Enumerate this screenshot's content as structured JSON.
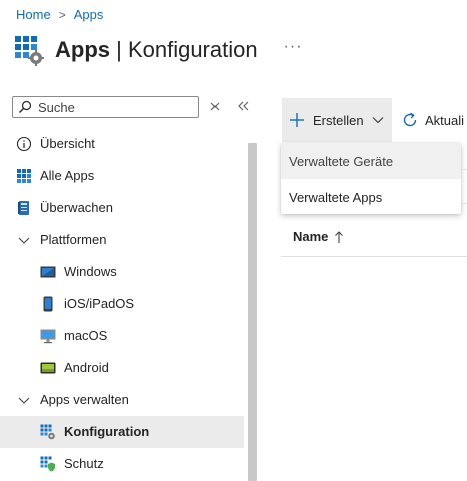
{
  "breadcrumb": {
    "home": "Home",
    "separator": ">",
    "apps": "Apps"
  },
  "header": {
    "title_bold": "Apps",
    "title_rest": " | Konfiguration",
    "more": "···"
  },
  "sidebar": {
    "search_placeholder": "Suche",
    "items": [
      {
        "label": "Übersicht",
        "icon": "info-icon"
      },
      {
        "label": "Alle Apps",
        "icon": "grid-apps-icon"
      },
      {
        "label": "Überwachen",
        "icon": "monitor-book-icon"
      },
      {
        "label": "Plattformen",
        "icon": "chevron-down-icon"
      },
      {
        "label": "Windows",
        "icon": "windows-device-icon"
      },
      {
        "label": "iOS/iPadOS",
        "icon": "ios-device-icon"
      },
      {
        "label": "macOS",
        "icon": "macos-device-icon"
      },
      {
        "label": "Android",
        "icon": "android-device-icon"
      },
      {
        "label": "Apps verwalten",
        "icon": "chevron-down-icon"
      },
      {
        "label": "Konfiguration",
        "icon": "apps-config-icon",
        "active": true
      },
      {
        "label": "Schutz",
        "icon": "apps-protection-icon"
      }
    ]
  },
  "toolbar": {
    "create_label": "Erstellen",
    "refresh_label": "Aktuali"
  },
  "create_menu": {
    "items": [
      "Verwaltete Geräte",
      "Verwaltete Apps"
    ]
  },
  "table": {
    "name_header": "Name",
    "sort_icon": "arrow-up-icon"
  },
  "colors": {
    "accent": "#0f6cbd",
    "active_bg": "#ebebeb",
    "text": "#242424"
  }
}
